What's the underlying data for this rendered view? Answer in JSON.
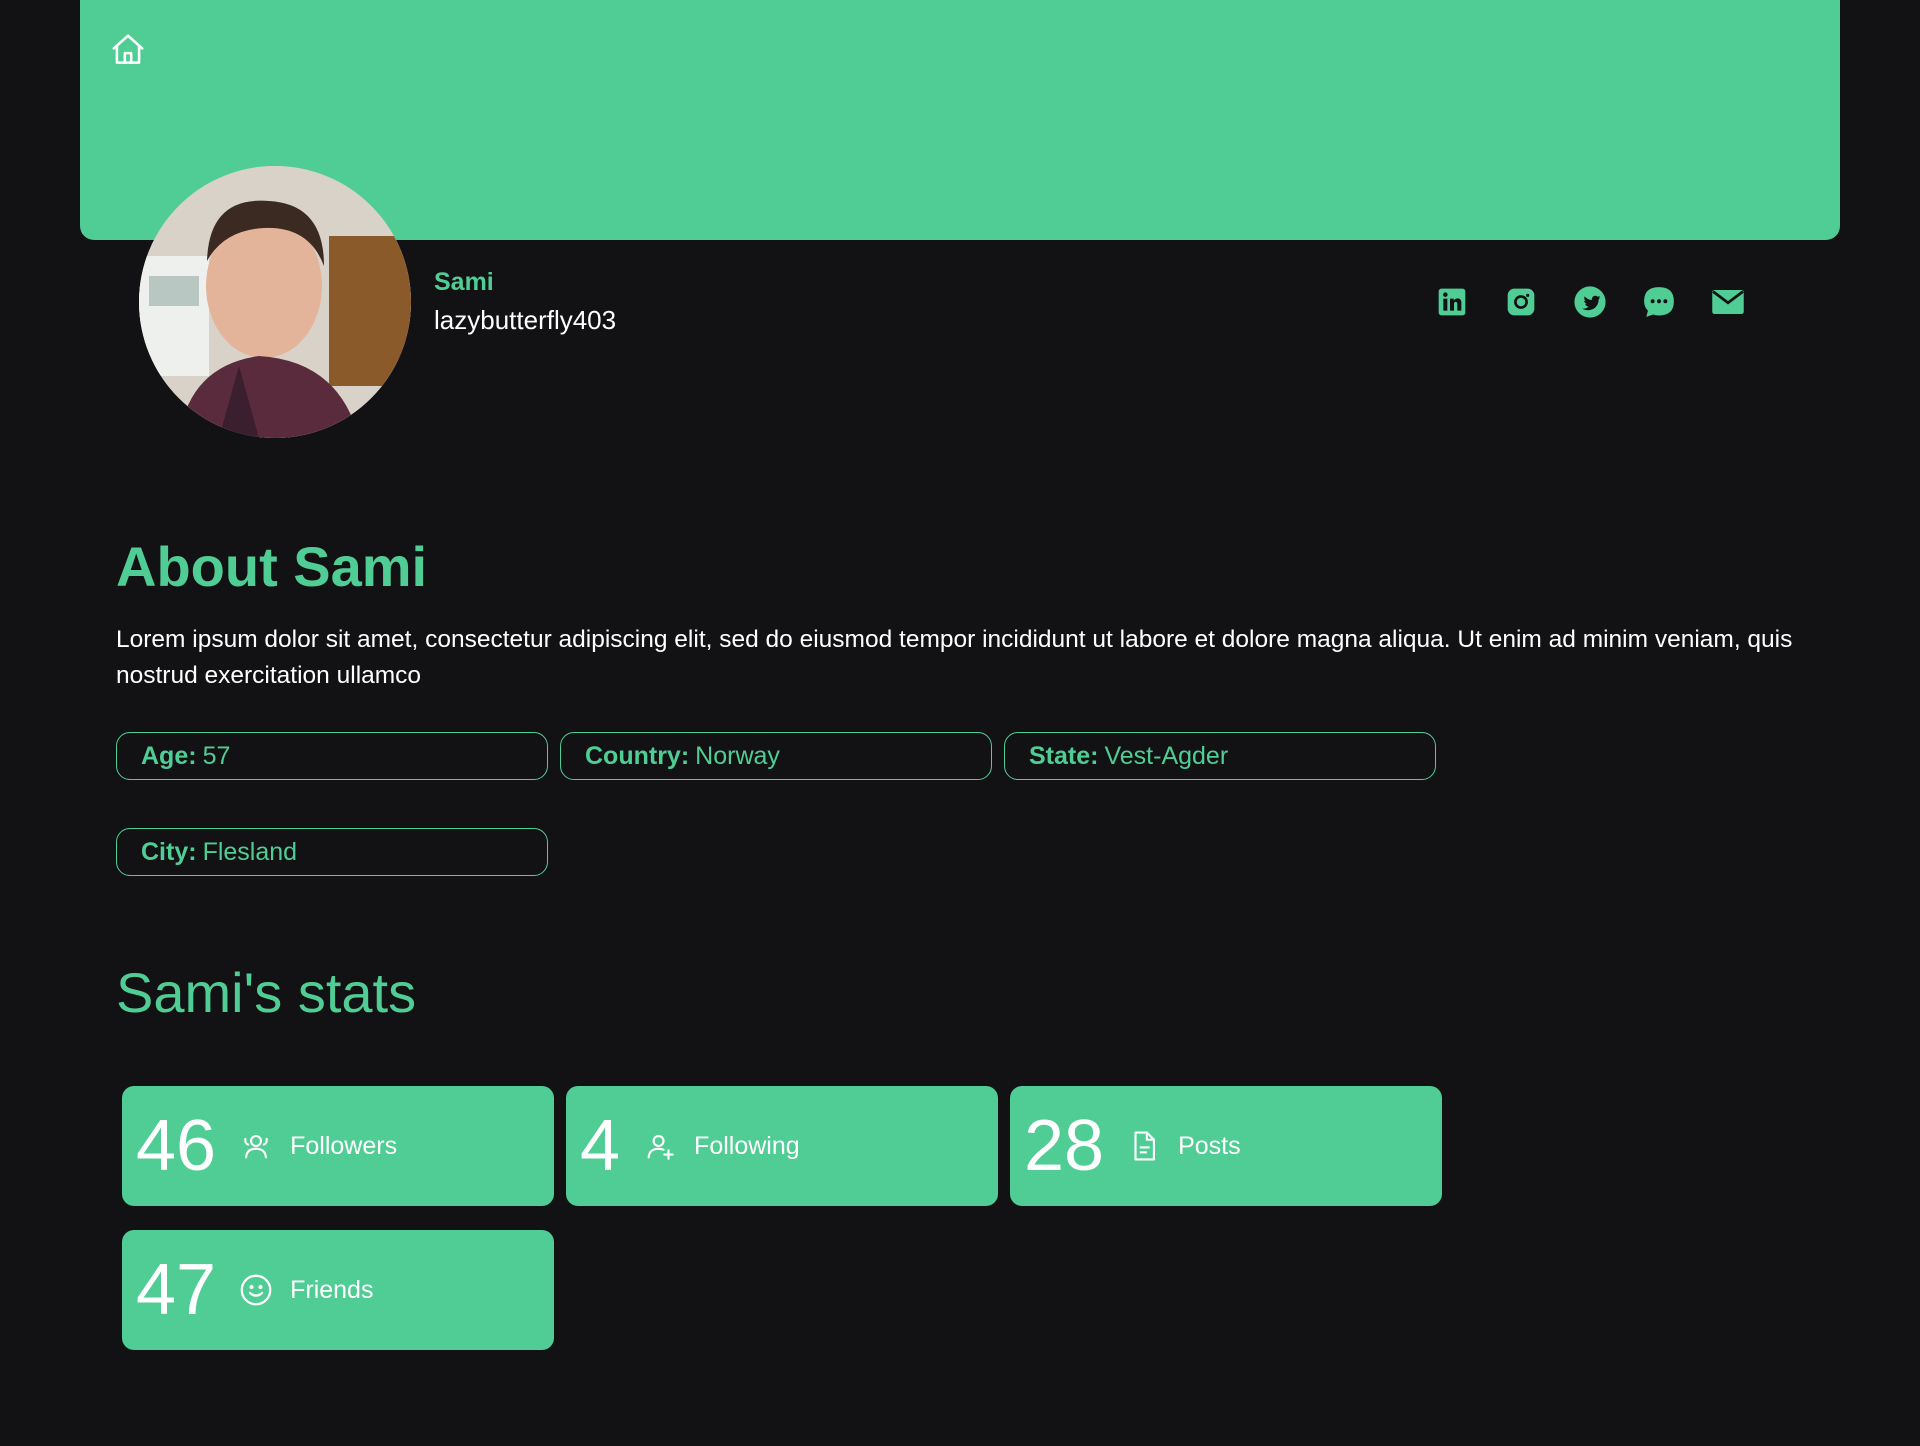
{
  "colors": {
    "accent": "#50cd94",
    "background": "#121214",
    "text": "#ffffff"
  },
  "nav": {
    "home_icon": "home-icon"
  },
  "profile": {
    "name": "Sami",
    "username": "lazybutterfly403",
    "avatar": "profile-photo",
    "socials": [
      {
        "icon": "linkedin-icon"
      },
      {
        "icon": "instagram-icon"
      },
      {
        "icon": "twitter-icon"
      },
      {
        "icon": "chat-icon"
      },
      {
        "icon": "mail-icon"
      }
    ]
  },
  "about": {
    "title": "About Sami",
    "text": "Lorem ipsum dolor sit amet, consectetur adipiscing elit, sed do eiusmod tempor incididunt ut labore et dolore magna aliqua. Ut enim ad minim veniam, quis nostrud exercitation ullamco",
    "info": [
      {
        "label": "Age:",
        "value": "57"
      },
      {
        "label": "Country:",
        "value": "Norway"
      },
      {
        "label": "State:",
        "value": "Vest-Agder"
      },
      {
        "label": "City:",
        "value": "Flesland"
      }
    ]
  },
  "stats": {
    "title": "Sami's stats",
    "items": [
      {
        "value": "46",
        "label": "Followers",
        "icon": "followers-icon"
      },
      {
        "value": "4",
        "label": "Following",
        "icon": "following-icon"
      },
      {
        "value": "28",
        "label": "Posts",
        "icon": "posts-icon"
      },
      {
        "value": "47",
        "label": "Friends",
        "icon": "friends-icon"
      }
    ]
  }
}
